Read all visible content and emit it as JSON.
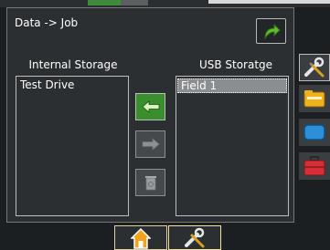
{
  "dialog": {
    "title": "Data -> Job"
  },
  "internal_storage": {
    "label": "Internal Storage",
    "items": [
      "Test Drive"
    ]
  },
  "usb_storage": {
    "label": "USB Storatge",
    "items": [
      "Field 1"
    ],
    "selected_item": "Field 1"
  },
  "icons": {
    "redo": "redo-arrow-icon",
    "copy_left": "arrow-left-icon",
    "copy_right": "arrow-right-icon",
    "delete": "recycle-bin-icon",
    "tools": "wrench-screwdriver-icon",
    "folder": "folder-icon",
    "display": "display-icon",
    "toolbox": "toolbox-icon",
    "home": "home-icon",
    "settings": "wrench-screwdriver-icon"
  },
  "colors": {
    "accent_green": "#3e8f2f",
    "tab_active": "#efe3a6",
    "tab_inactive_border": "#e0d3a0",
    "folder_yellow": "#f1b21c",
    "display_blue": "#2b8fd6",
    "toolbox_red": "#d62e36"
  }
}
